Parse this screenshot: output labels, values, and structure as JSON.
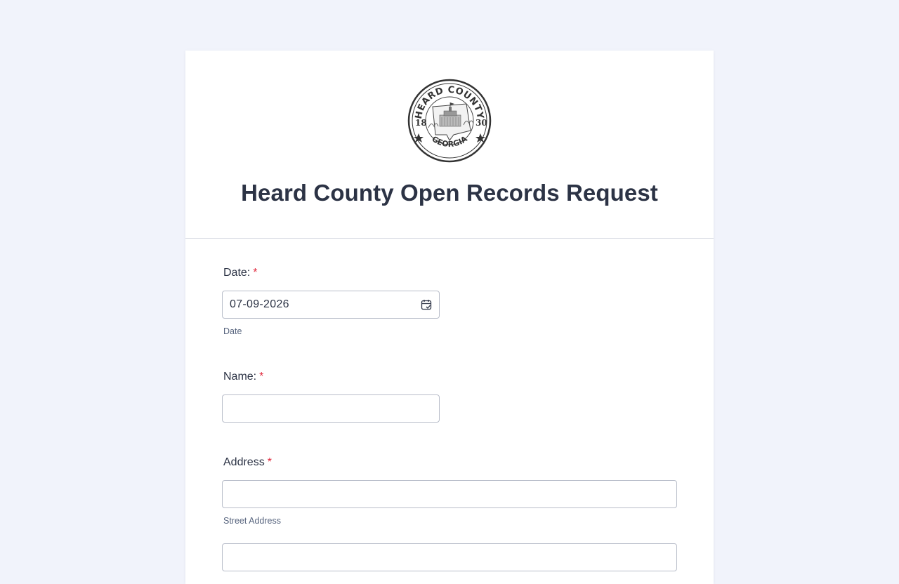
{
  "form": {
    "title": "Heard County Open Records Request",
    "seal": {
      "top_text": "HEARD COUNTY",
      "bottom_text": "GEORGIA",
      "year_left": "18",
      "year_right": "30"
    }
  },
  "fields": {
    "date": {
      "label": "Date:",
      "required_mark": "*",
      "value": "07-09-2026",
      "sublabel": "Date"
    },
    "name": {
      "label": "Name:",
      "required_mark": "*",
      "value": ""
    },
    "address": {
      "label": "Address",
      "required_mark": "*",
      "street_value": "",
      "street_sublabel": "Street Address",
      "line2_value": ""
    }
  },
  "colors": {
    "page_background": "#f1f3fb",
    "card_background": "#ffffff",
    "text": "#2c3345",
    "required": "#e0283c",
    "input_border": "#b8bdc9"
  },
  "icons": {
    "date_picker": "calendar-icon"
  }
}
